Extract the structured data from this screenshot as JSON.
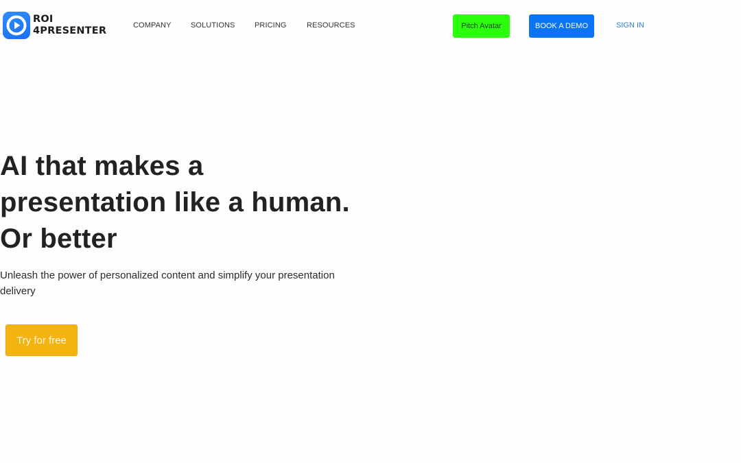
{
  "brand": {
    "name_line1": "ROI",
    "name_line2": "4PRESENTER",
    "icon": "play-icon",
    "color": "#1a7cf5"
  },
  "nav": {
    "items": [
      {
        "label": "COMPANY"
      },
      {
        "label": "SOLUTIONS"
      },
      {
        "label": "PRICING"
      },
      {
        "label": "RESOURCES"
      }
    ]
  },
  "header_actions": {
    "pitch_avatar_label": "Pitch Avatar",
    "pitch_avatar_color": "#2bff0d",
    "book_demo_label": "BOOK A DEMO",
    "book_demo_color": "#0a74f5",
    "sign_in_label": "SIGN IN",
    "sign_in_color": "#2c7fd8"
  },
  "hero": {
    "title_lines": [
      "AI that makes a",
      "presentation like a human.",
      "Or better"
    ],
    "subtitle": "Unleash the power of personalized content and simplify your presentation delivery",
    "cta_label": "Try for free",
    "cta_color": "#f5b312"
  }
}
